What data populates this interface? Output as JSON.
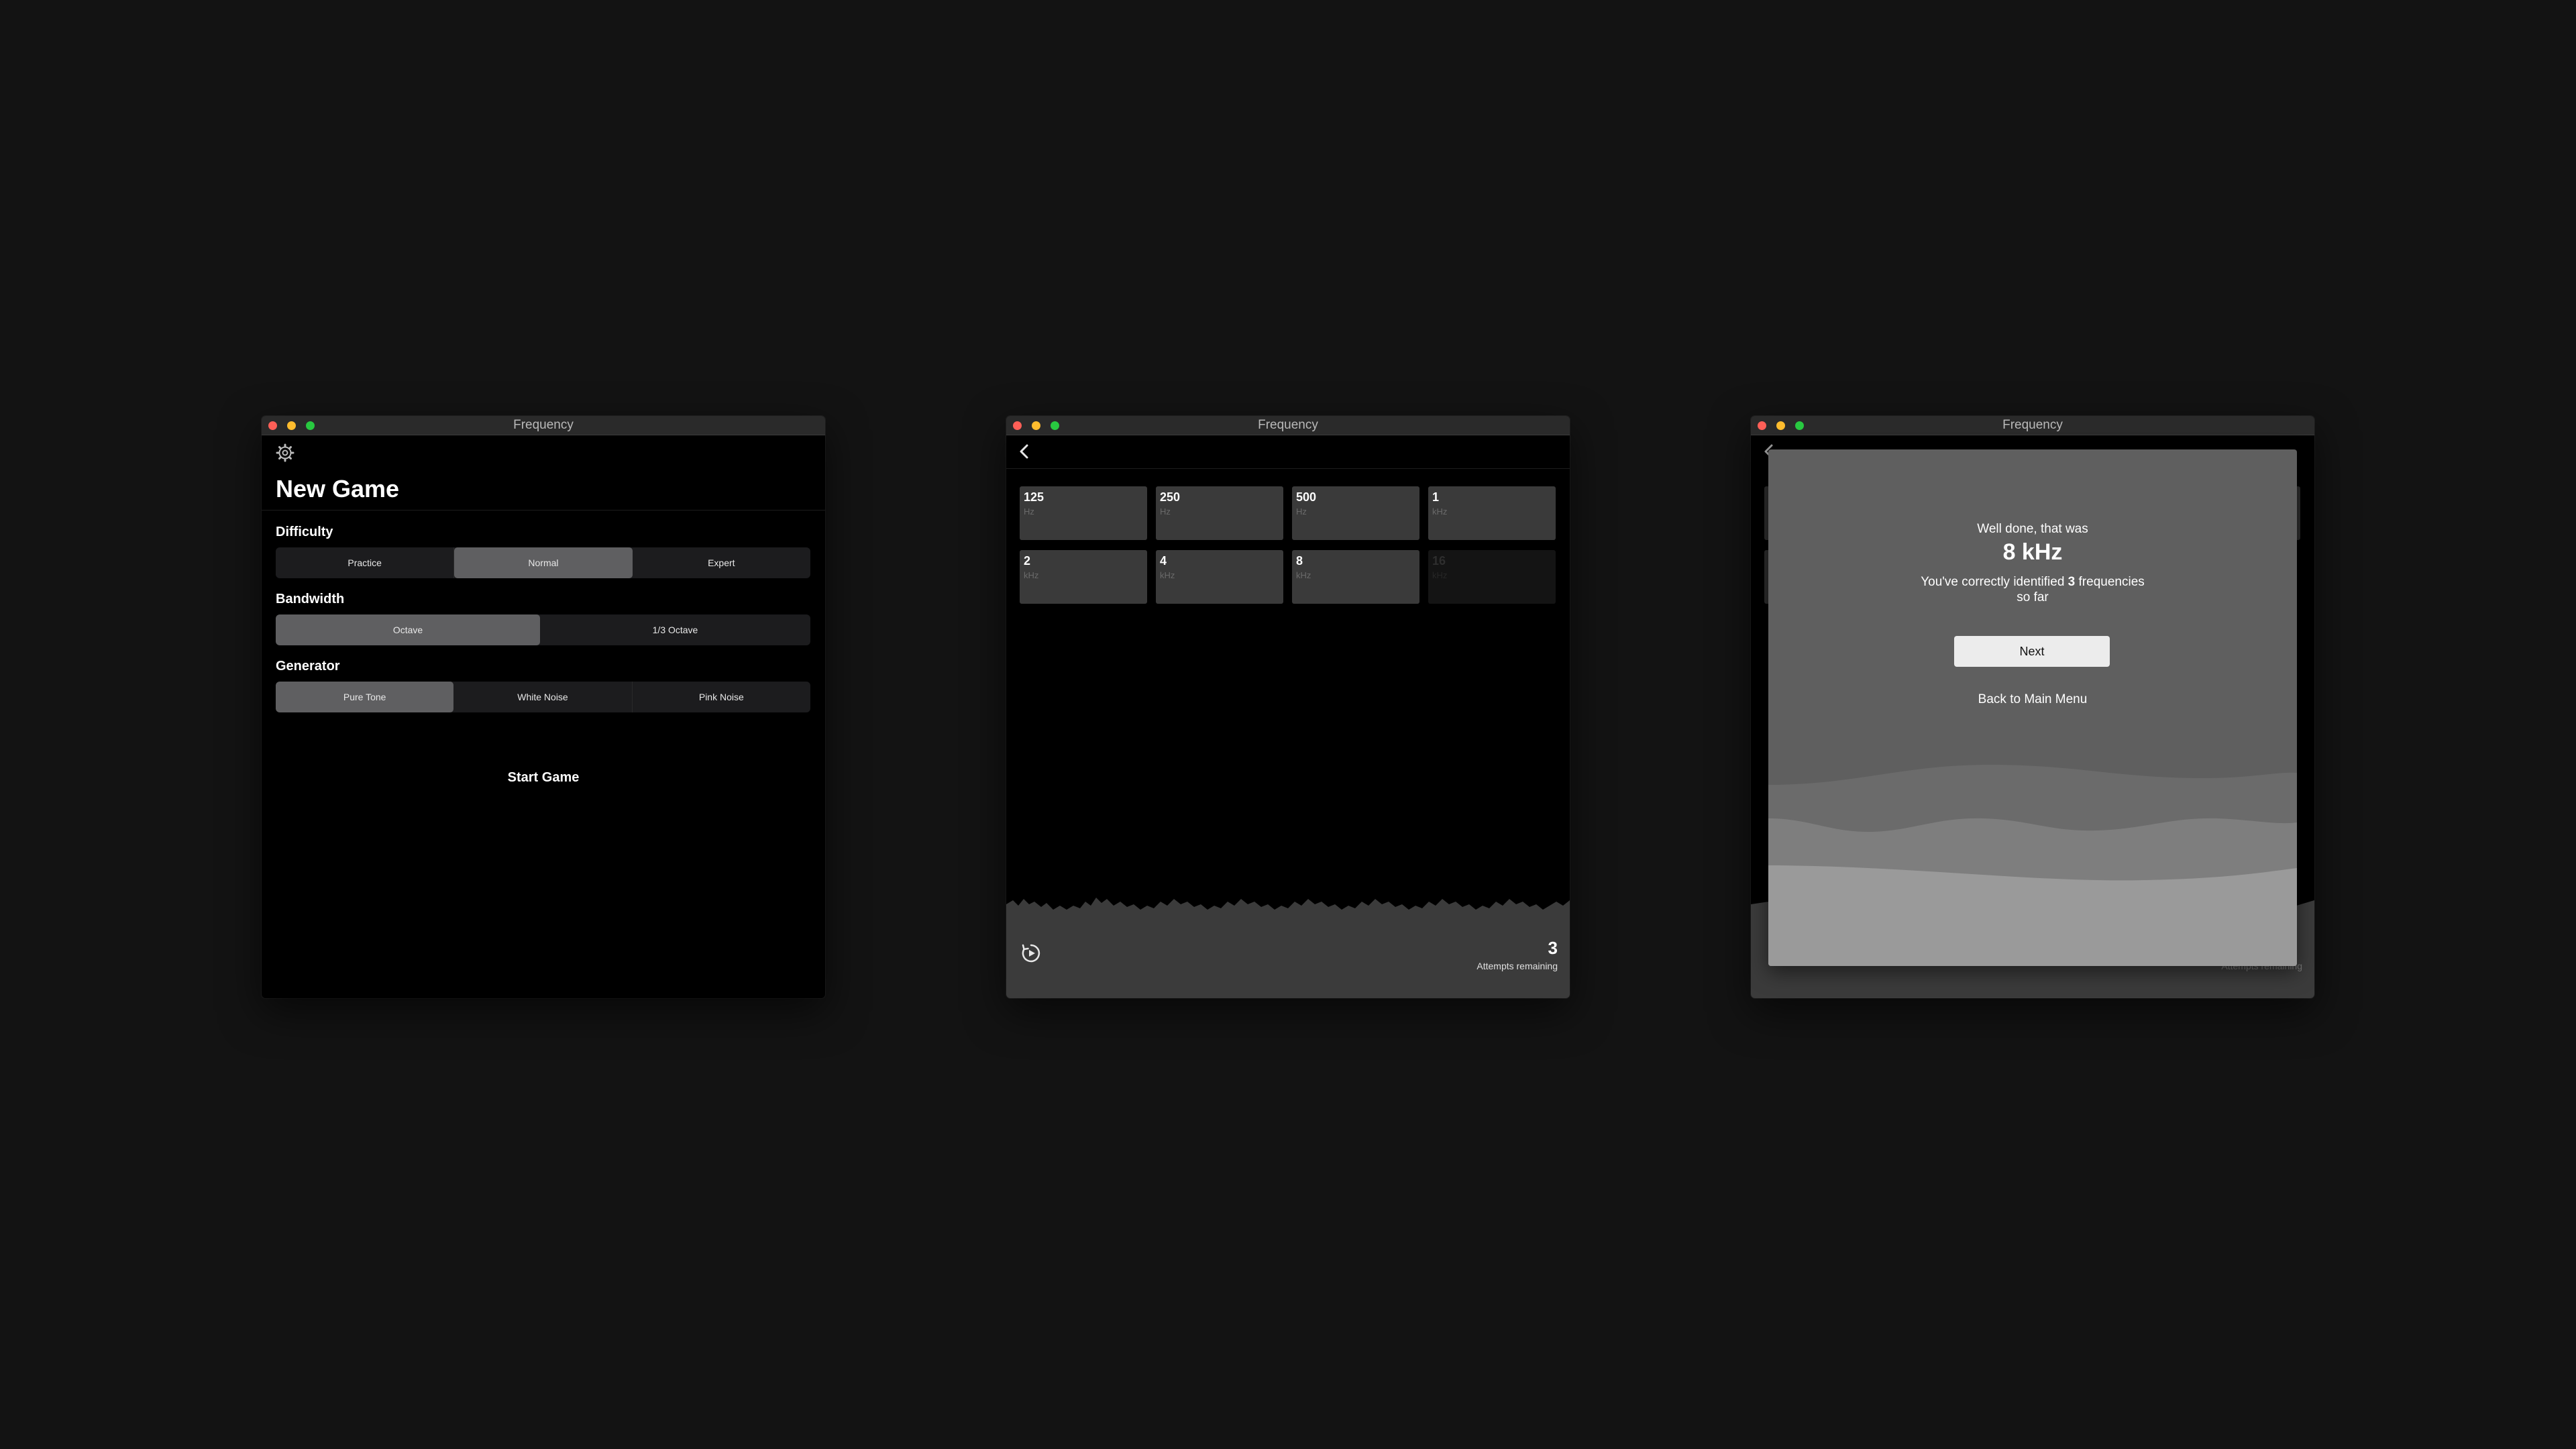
{
  "windows": {
    "settings": {
      "title": "Frequency",
      "page_title": "New Game",
      "difficulty": {
        "label": "Difficulty",
        "options": [
          "Practice",
          "Normal",
          "Expert"
        ],
        "selected": "Normal"
      },
      "bandwidth": {
        "label": "Bandwidth",
        "options": [
          "Octave",
          "1/3 Octave"
        ],
        "selected": "Octave"
      },
      "generator": {
        "label": "Generator",
        "options": [
          "Pure Tone",
          "White Noise",
          "Pink Noise"
        ],
        "selected": "Pure Tone"
      },
      "start_label": "Start Game"
    },
    "game": {
      "title": "Frequency",
      "tiles": [
        {
          "value": "125",
          "unit": "Hz"
        },
        {
          "value": "250",
          "unit": "Hz"
        },
        {
          "value": "500",
          "unit": "Hz"
        },
        {
          "value": "1",
          "unit": "kHz"
        },
        {
          "value": "2",
          "unit": "kHz"
        },
        {
          "value": "4",
          "unit": "kHz"
        },
        {
          "value": "8",
          "unit": "kHz"
        },
        {
          "value": "16",
          "unit": "kHz",
          "disabled": true
        }
      ],
      "attempts_count": "3",
      "attempts_label": "Attempts remaining"
    },
    "result": {
      "title": "Frequency",
      "line1": "Well done, that was",
      "frequency": "8 kHz",
      "identified_prefix": "You've correctly identified ",
      "identified_count": "3",
      "identified_suffix": " frequencies",
      "identified_suffix2": "so far",
      "next_label": "Next",
      "back_label": "Back to Main Menu",
      "attempts_label": "Attempts remaining"
    }
  },
  "colors": {
    "desktop": "#131313",
    "window": "#000000",
    "segment_bg": "#1c1c1e",
    "segment_selected": "#5f5f61",
    "tile": "#3a3a3a",
    "modal": "#5f5f5f"
  },
  "icons": [
    "gear-icon",
    "chevron-left-icon",
    "replay-icon"
  ]
}
